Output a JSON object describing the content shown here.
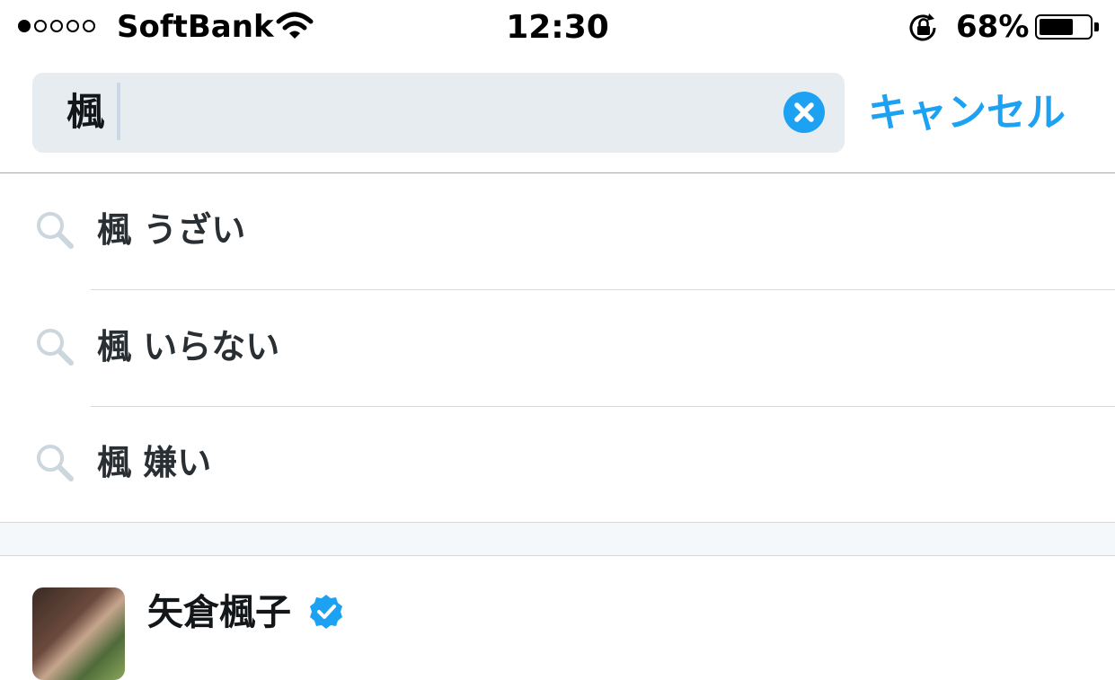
{
  "status_bar": {
    "carrier": "SoftBank",
    "signal_bars_filled": 1,
    "signal_bars_total": 5,
    "time": "12:30",
    "battery_percent": "68%",
    "battery_level": 0.68,
    "icons": [
      "wifi-icon",
      "rotation-lock-icon",
      "battery-icon"
    ]
  },
  "search": {
    "query": "楓",
    "cancel_label": "キャンセル",
    "clear_icon": "clear-icon",
    "accent_color": "#1da1f2"
  },
  "suggestions": [
    {
      "text": "楓 うざい",
      "icon": "search-icon"
    },
    {
      "text": "楓 いらない",
      "icon": "search-icon"
    },
    {
      "text": "楓 嫌い",
      "icon": "search-icon"
    }
  ],
  "users": [
    {
      "name": "矢倉楓子",
      "verified": true
    }
  ]
}
